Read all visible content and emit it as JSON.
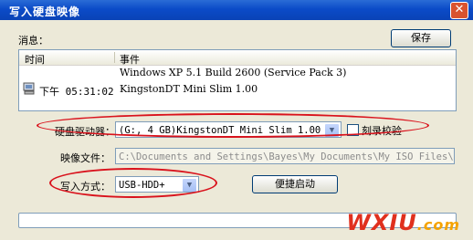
{
  "window": {
    "title": "写入硬盘映像",
    "close_label": "✕"
  },
  "messages": {
    "label": "消息：",
    "save_label": "保存",
    "columns": {
      "time": "时间",
      "event": "事件"
    },
    "rows": [
      {
        "icon": "computer-icon",
        "time": "下午 05:31:02",
        "event_lines": [
          "Windows XP 5.1 Build 2600  (Service Pack 3)",
          "KingstonDT Mini Slim     1.00"
        ]
      }
    ]
  },
  "drive": {
    "label": "硬盘驱动器：",
    "selected": "(G:, 4 GB)KingstonDT Mini Slim     1.00",
    "verify_label": "刻录校验"
  },
  "image_file": {
    "label": "映像文件：",
    "value": "C:\\Documents and Settings\\Bayes\\My Documents\\My ISO Files\\t"
  },
  "write_mode": {
    "label": "写入方式：",
    "selected": "USB-HDD+",
    "boot_button": "便捷启动"
  },
  "progress": {
    "value": 0
  },
  "watermark": {
    "main": "WXIU",
    "tail": ".com"
  },
  "colors": {
    "highlight_oval": "#d9121c",
    "title_bar": "#0b4bc8"
  }
}
